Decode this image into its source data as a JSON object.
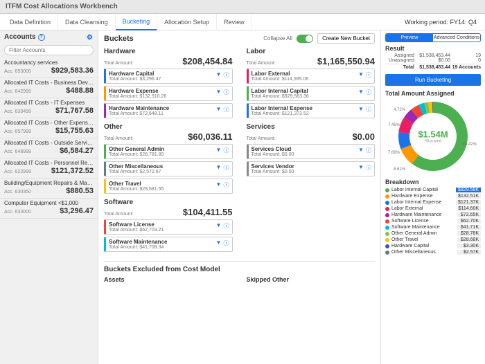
{
  "header": {
    "title": "ITFM Cost Allocations Workbench"
  },
  "tabs": [
    "Data Definition",
    "Data Cleansing",
    "Bucketing",
    "Allocation Setup",
    "Review"
  ],
  "active_tab": 2,
  "working_period": "Working period: FY14: Q4",
  "sidebar": {
    "title": "Accounts",
    "search_placeholder": "Filter Accounts",
    "accounts": [
      {
        "name": "Accountancy services",
        "id": "Acc. 653000",
        "amount": "$929,583.36"
      },
      {
        "name": "Allocated IT Costs - Business Devel...",
        "id": "Acc. 642999",
        "amount": "$488.88"
      },
      {
        "name": "Allocated IT Costs - IT Expenses",
        "id": "Acc. 633499",
        "amount": "$71,767.58"
      },
      {
        "name": "Allocated IT Costs - Other Expenses",
        "id": "Acc. 657999",
        "amount": "$15,755.63"
      },
      {
        "name": "Allocated IT Costs - Outside Servic...",
        "id": "Acc. 648999",
        "amount": "$6,584.27"
      },
      {
        "name": "Allocated IT Costs - Personnel Relat...",
        "id": "Acc. 622999",
        "amount": "$121,372.52"
      },
      {
        "name": "Building/Equipment Repairs & Maint...",
        "id": "Acc. 630350",
        "amount": "$880.53"
      },
      {
        "name": "Computer Equipment <$1,000",
        "id": "Acc. 633000",
        "amount": "$3,296.47"
      }
    ]
  },
  "buckets": {
    "title": "Buckets",
    "collapse_label": "Collapse All",
    "new_button": "Create New Bucket",
    "categories": [
      {
        "name": "Hardware",
        "total": "$208,454.84",
        "items": [
          {
            "name": "Hardware Capital",
            "total": "Total Amount: $3,296.47",
            "color": "#1a73e8"
          },
          {
            "name": "Hardware Expense",
            "total": "Total Amount: $132,510.26",
            "color": "#ff9800"
          },
          {
            "name": "Hardware Maintenance",
            "total": "Total Amount: $72,648.11",
            "color": "#9c27b0"
          }
        ]
      },
      {
        "name": "Labor",
        "total": "$1,165,550.94",
        "items": [
          {
            "name": "Labor External",
            "total": "Total Amount: $114,595.06",
            "color": "#e91e63"
          },
          {
            "name": "Labor Internal Capital",
            "total": "Total Amount: $929,583.36",
            "color": "#4caf50"
          },
          {
            "name": "Labor Internal Expense",
            "total": "Total Amount: $121,372.52",
            "color": "#1a73e8"
          }
        ]
      },
      {
        "name": "Other",
        "total": "$60,036.11",
        "items": [
          {
            "name": "Other General Admin",
            "total": "Total Amount: $28,781.89",
            "color": "#4caf50"
          },
          {
            "name": "Other Miscellaneous",
            "total": "Total Amount: $2,572.67",
            "color": "#607d8b"
          },
          {
            "name": "Other Travel",
            "total": "Total Amount: $28,681.55",
            "color": "#ffc107"
          }
        ]
      },
      {
        "name": "Services",
        "total": "$0.00",
        "items": [
          {
            "name": "Services Cloud",
            "total": "Total Amount: $0.00",
            "color": "#888"
          },
          {
            "name": "Services Vendor",
            "total": "Total Amount: $0.00",
            "color": "#888"
          }
        ]
      },
      {
        "name": "Software",
        "total": "$104,411.55",
        "items": [
          {
            "name": "Software License",
            "total": "Total Amount: $62,703.21",
            "color": "#f44336"
          },
          {
            "name": "Software Maintenance",
            "total": "Total Amount: $41,708.34",
            "color": "#00bcd4"
          }
        ]
      }
    ],
    "excluded_title": "Buckets Excluded from Cost Model",
    "excluded": [
      "Assets",
      "Skipped Other"
    ]
  },
  "right": {
    "seg": [
      "Preview",
      "Advanced Conditions"
    ],
    "result_title": "Result",
    "results": [
      {
        "label": "Assigned",
        "amount": "$1,538,453.44",
        "count": "19"
      },
      {
        "label": "Unassigned",
        "amount": "$0.00",
        "count": "0"
      },
      {
        "label": "Total",
        "amount": "$1,538,453.44",
        "count": "19 Accounts"
      }
    ],
    "run_label": "Run Bucketing",
    "chart_title": "Total Amount Assigned",
    "donut_center": "$1.54M",
    "donut_sub": "Allocated",
    "pct_labels": [
      "60.42%",
      "8.61%",
      "7.89%",
      "7.45%",
      "4.72%"
    ],
    "breakdown_title": "Breakdown",
    "breakdown": [
      {
        "label": "Labor Internal Capital",
        "value": "$929.58K",
        "color": "#4caf50",
        "active": true
      },
      {
        "label": "Hardware Expense",
        "value": "$132.51K",
        "color": "#ff9800"
      },
      {
        "label": "Labor Internal Expense",
        "value": "$121.37K",
        "color": "#1a73e8"
      },
      {
        "label": "Labor External",
        "value": "$114.60K",
        "color": "#e91e63"
      },
      {
        "label": "Hardware Maintenance",
        "value": "$72.65K",
        "color": "#9c27b0"
      },
      {
        "label": "Software License",
        "value": "$62.70K",
        "color": "#f44336"
      },
      {
        "label": "Software Maintenance",
        "value": "$41.71K",
        "color": "#00bcd4"
      },
      {
        "label": "Other General Admin",
        "value": "$28.78K",
        "color": "#8bc34a"
      },
      {
        "label": "Other Travel",
        "value": "$28.68K",
        "color": "#ffc107"
      },
      {
        "label": "Hardware Capital",
        "value": "$3.30K",
        "color": "#3f51b5"
      },
      {
        "label": "Other Miscellaneous",
        "value": "$2.57K",
        "color": "#607d8b"
      }
    ]
  },
  "chart_data": {
    "type": "pie",
    "title": "Total Amount Assigned",
    "total": 1538453.44,
    "series": [
      {
        "name": "Labor Internal Capital",
        "value": 929583.36,
        "pct": 60.42
      },
      {
        "name": "Hardware Expense",
        "value": 132510.26,
        "pct": 8.61
      },
      {
        "name": "Labor Internal Expense",
        "value": 121372.52,
        "pct": 7.89
      },
      {
        "name": "Labor External",
        "value": 114595.06,
        "pct": 7.45
      },
      {
        "name": "Hardware Maintenance",
        "value": 72648.11,
        "pct": 4.72
      },
      {
        "name": "Software License",
        "value": 62703.21,
        "pct": 4.08
      },
      {
        "name": "Software Maintenance",
        "value": 41708.34,
        "pct": 2.71
      },
      {
        "name": "Other General Admin",
        "value": 28781.89,
        "pct": 1.87
      },
      {
        "name": "Other Travel",
        "value": 28681.55,
        "pct": 1.86
      },
      {
        "name": "Hardware Capital",
        "value": 3296.47,
        "pct": 0.21
      },
      {
        "name": "Other Miscellaneous",
        "value": 2572.67,
        "pct": 0.17
      }
    ]
  }
}
